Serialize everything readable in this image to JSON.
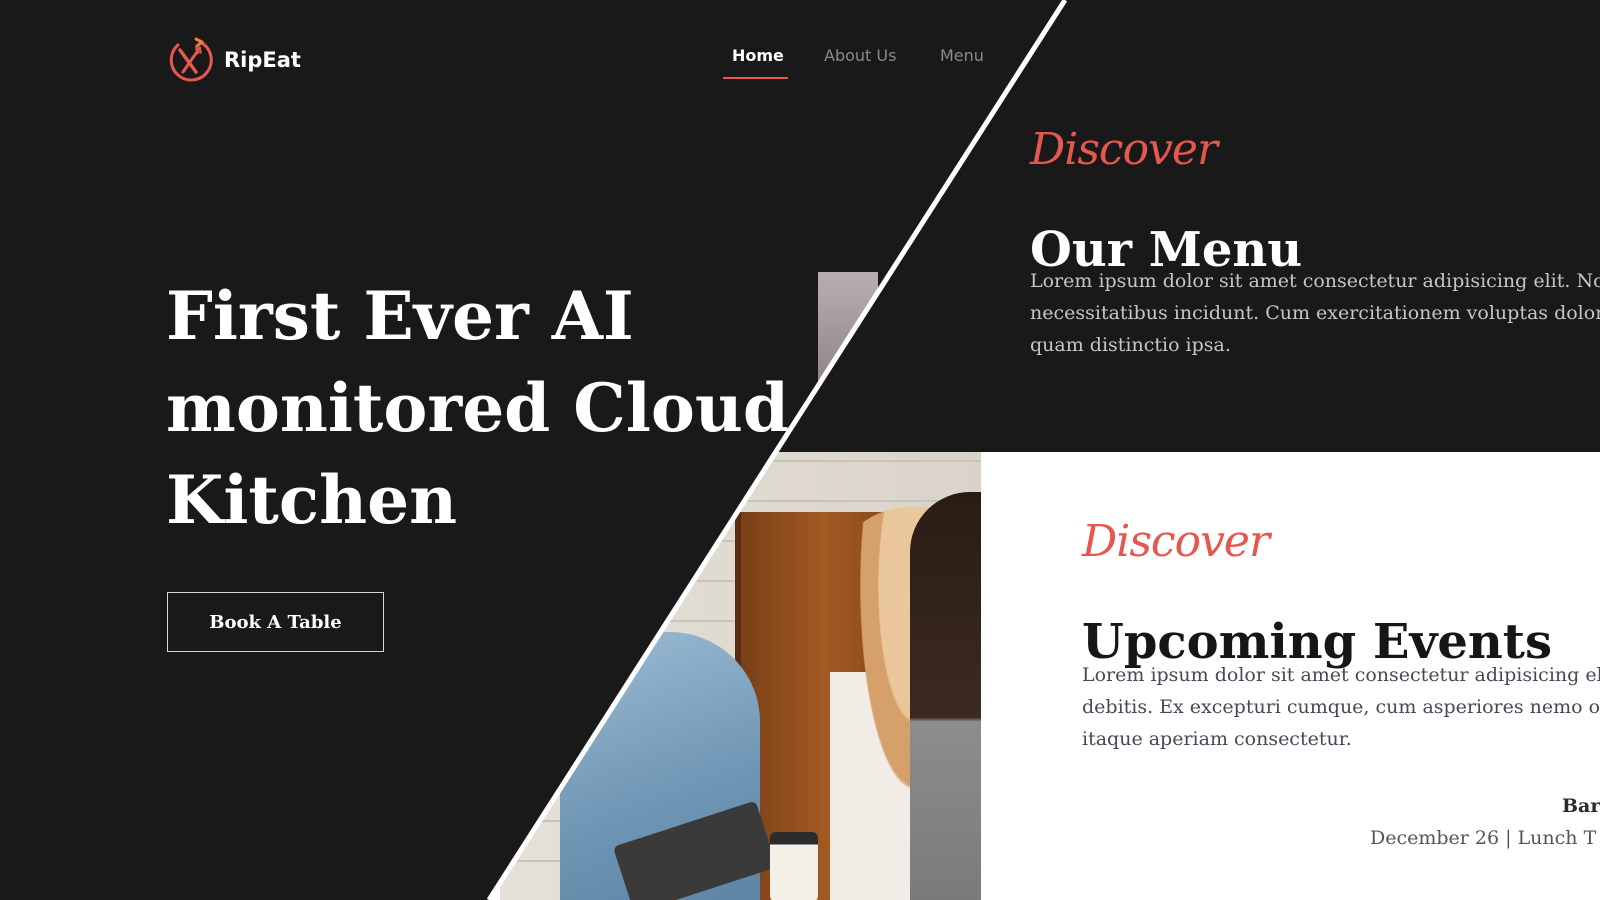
{
  "brand": {
    "name": "RipEat",
    "logo_icon": "fork-knife-circle-icon",
    "accent_color": "#e5574f"
  },
  "nav": {
    "items": [
      {
        "label": "Home",
        "active": true
      },
      {
        "label": "About Us",
        "active": false
      },
      {
        "label": "Menu",
        "active": false
      }
    ]
  },
  "hero": {
    "title_lines": [
      "First Ever AI",
      "monitored Cloud",
      "Kitchen"
    ],
    "cta_label": "Book A Table"
  },
  "menu_section": {
    "kicker": "Discover",
    "title": "Our Menu",
    "paragraph_lines": [
      "Lorem ipsum dolor sit amet consectetur adipisicing elit. Nob",
      "necessitatibus incidunt. Cum exercitationem voluptas dolor",
      "quam distinctio ipsa."
    ]
  },
  "events_section": {
    "kicker": "Discover",
    "title": "Upcoming Events",
    "paragraph_lines": [
      "Lorem ipsum dolor sit amet consectetur adipisicing el",
      "debitis. Ex excepturi cumque, cum asperiores nemo ol",
      "itaque aperiam consectetur."
    ],
    "event_name": "Bar",
    "event_date": "December 26 | Lunch T"
  },
  "colors": {
    "dark_bg": "#191919",
    "light_bg": "#ffffff",
    "accent": "#e5574f"
  }
}
